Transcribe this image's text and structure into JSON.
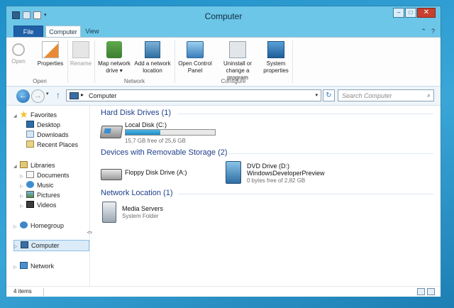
{
  "window": {
    "title": "Computer",
    "controls": {
      "minimize": "‒",
      "maximize": "□",
      "close": "✕"
    }
  },
  "ribbon_tabs": [
    {
      "label": "File"
    },
    {
      "label": "Computer",
      "active": true
    },
    {
      "label": "View"
    }
  ],
  "tab_icons": {
    "minimize_ribbon": "⌃",
    "help": "?"
  },
  "ribbon": {
    "groups": [
      {
        "label": "Open",
        "buttons": [
          {
            "label_line1": "Open",
            "icon": "open-icon",
            "disabled": true
          },
          {
            "label_line1": "Properties",
            "icon": "properties-icon"
          }
        ]
      },
      {
        "label": "",
        "buttons": [
          {
            "label_line1": "Rename",
            "icon": "rename-icon",
            "disabled": true
          }
        ]
      },
      {
        "label": "Network",
        "buttons": [
          {
            "label_line1": "Map network",
            "label_line2": "drive ▾",
            "icon": "map-network-drive-icon"
          },
          {
            "label_line1": "Add a network",
            "label_line2": "location",
            "icon": "add-network-location-icon"
          }
        ]
      },
      {
        "label": "Configure",
        "buttons": [
          {
            "label_line1": "Open Control",
            "label_line2": "Panel",
            "icon": "control-panel-icon"
          },
          {
            "label_line1": "Uninstall or",
            "label_line2": "change a program",
            "icon": "uninstall-icon"
          },
          {
            "label_line1": "System",
            "label_line2": "properties",
            "icon": "system-properties-icon"
          }
        ]
      }
    ]
  },
  "address_bar": {
    "back": "←",
    "forward": "→",
    "recent_dropdown": "▾",
    "up": "↑",
    "chevron": "▸",
    "path": "Computer",
    "dropdown": "▾",
    "refresh": "↻"
  },
  "search": {
    "placeholder": "Search Computer",
    "icon": "⌕"
  },
  "nav_pane": {
    "favorites": {
      "label": "Favorites",
      "items": [
        {
          "label": "Desktop"
        },
        {
          "label": "Downloads"
        },
        {
          "label": "Recent Places"
        }
      ]
    },
    "libraries": {
      "label": "Libraries",
      "items": [
        {
          "label": "Documents"
        },
        {
          "label": "Music"
        },
        {
          "label": "Pictures"
        },
        {
          "label": "Videos"
        }
      ]
    },
    "homegroup": {
      "label": "Homegroup"
    },
    "computer": {
      "label": "Computer",
      "selected": true
    },
    "network": {
      "label": "Network"
    },
    "tri_expanded": "◢",
    "tri_collapsed": "▷"
  },
  "groups": [
    {
      "title": "Hard Disk Drives (1)",
      "items": [
        {
          "name": "Local Disk (C:)",
          "detail": "15,7 GB free of 25,6 GB",
          "used_fraction": 0.387,
          "icon": "hard-disk-icon"
        }
      ]
    },
    {
      "title": "Devices with Removable Storage (2)",
      "items": [
        {
          "name": "Floppy Disk Drive (A:)",
          "icon": "floppy-drive-icon"
        },
        {
          "name": "DVD Drive (D:)",
          "name2": "WindowsDeveloperPreview",
          "detail": "0 bytes free of 2,82 GB",
          "icon": "dvd-drive-icon"
        }
      ]
    },
    {
      "title": "Network Location (1)",
      "items": [
        {
          "name": "Media Servers",
          "detail": "System Folder",
          "icon": "media-server-icon"
        }
      ]
    }
  ],
  "cursor": "⇔",
  "status": {
    "items_count": "4 items"
  }
}
